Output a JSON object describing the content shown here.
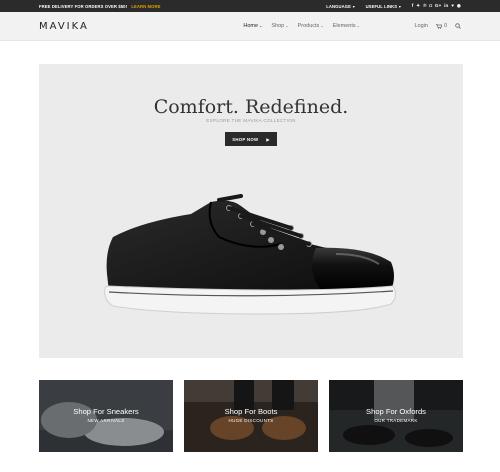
{
  "topbar": {
    "promo": "FREE DELIVERY FOR ORDERS OVER $50!",
    "learn_more": "LEARN MORE",
    "language": "LANGUAGE",
    "useful_links": "USEFUL LINKS",
    "social_icons": [
      "facebook-icon",
      "twitter-icon",
      "pinterest-icon",
      "instagram-icon",
      "google-plus-icon",
      "linkedin-icon",
      "heart-icon",
      "dribbble-icon"
    ]
  },
  "header": {
    "logo": "MAVIKA",
    "nav": [
      "Home",
      "Shop",
      "Products",
      "Elements"
    ],
    "login": "Login",
    "cart_count": "0"
  },
  "hero": {
    "title": "Comfort. Redefined.",
    "subtitle": "EXPLORE THE MAVIKA COLLECTION",
    "cta": "SHOP NOW"
  },
  "cards": [
    {
      "title": "Shop For Sneakers",
      "subtitle": "NEW ARRIVALS"
    },
    {
      "title": "Shop For Boots",
      "subtitle": "HUGE DISCOUNTS"
    },
    {
      "title": "Shop For Oxfords",
      "subtitle": "OUR TRADEMARK"
    }
  ],
  "colors": {
    "accent": "#e0a100",
    "dark": "#2b2b2b",
    "hero_bg": "#ebebeb"
  }
}
